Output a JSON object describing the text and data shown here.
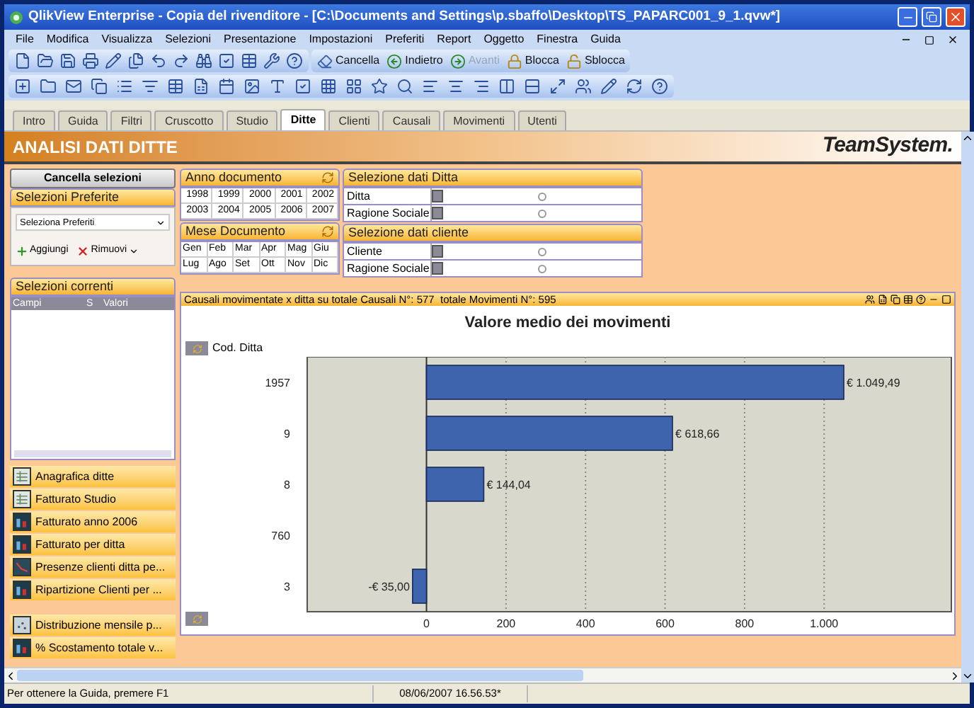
{
  "window": {
    "title": "QlikView Enterprise - Copia del rivenditore - [C:\\Documents and Settings\\p.sbaffo\\Desktop\\TS_PAPARC001_9_1.qvw*]"
  },
  "menu": [
    "File",
    "Modifica",
    "Visualizza",
    "Selezioni",
    "Presentazione",
    "Impostazioni",
    "Preferiti",
    "Report",
    "Oggetto",
    "Finestra",
    "Guida"
  ],
  "toolbar_buttons": [
    {
      "label": "Cancella",
      "kind": "eraser",
      "disabled": false
    },
    {
      "label": "Indietro",
      "kind": "back",
      "disabled": false
    },
    {
      "label": "Avanti",
      "kind": "forward",
      "disabled": true
    },
    {
      "label": "Blocca",
      "kind": "lock",
      "disabled": false
    },
    {
      "label": "Sblocca",
      "kind": "unlock",
      "disabled": false
    }
  ],
  "tabs": [
    {
      "label": "Intro",
      "selected": false
    },
    {
      "label": "Guida",
      "selected": false
    },
    {
      "label": "Filtri",
      "selected": false
    },
    {
      "label": "Cruscotto",
      "selected": false
    },
    {
      "label": "Studio",
      "selected": false
    },
    {
      "label": "Ditte",
      "selected": true
    },
    {
      "label": "Clienti",
      "selected": false
    },
    {
      "label": "Causali",
      "selected": false
    },
    {
      "label": "Movimenti",
      "selected": false
    },
    {
      "label": "Utenti",
      "selected": false
    }
  ],
  "header": {
    "title": "ANALISI DATI DITTE",
    "logo": "TeamSystem."
  },
  "left_panel": {
    "clear_button": "Cancella selezioni",
    "favorites": {
      "title": "Selezioni Preferite",
      "dropdown": "Seleziona Preferiti",
      "add": "Aggiungi",
      "remove": "Rimuovi"
    },
    "current": {
      "title": "Selezioni correnti",
      "columns": [
        "Campi",
        "S",
        "Valori"
      ]
    },
    "report_groups": [
      [
        {
          "label": "Anagrafica ditte",
          "kind": "table"
        },
        {
          "label": "Fatturato Studio",
          "kind": "table"
        },
        {
          "label": "Fatturato anno 2006",
          "kind": "bar"
        },
        {
          "label": "Fatturato per ditta",
          "kind": "bar"
        },
        {
          "label": "Presenze clienti ditta pe...",
          "kind": "line"
        },
        {
          "label": "Ripartizione Clienti per ...",
          "kind": "bar"
        }
      ],
      [
        {
          "label": "Distribuzione mensile p...",
          "kind": "scatter"
        },
        {
          "label": "% Scostamento totale v...",
          "kind": "bar"
        }
      ]
    ]
  },
  "anno_documento": {
    "title": "Anno documento",
    "values": [
      "1998",
      "1999",
      "2000",
      "2001",
      "2002",
      "2003",
      "2004",
      "2005",
      "2006",
      "2007"
    ]
  },
  "mese_documento": {
    "title": "Mese Documento",
    "values": [
      "Gen",
      "Feb",
      "Mar",
      "Apr",
      "Mag",
      "Giu",
      "Lug",
      "Ago",
      "Set",
      "Ott",
      "Nov",
      "Dic"
    ]
  },
  "selezione_ditta": {
    "title": "Selezione dati Ditta",
    "fields": [
      "Ditta",
      "Ragione Sociale"
    ]
  },
  "selezione_cliente": {
    "title": "Selezione dati cliente",
    "fields": [
      "Cliente",
      "Ragione Sociale"
    ]
  },
  "chart_panel": {
    "caption": "Causali movimentate x ditta su totale Causali N°: 577  totale Movimenti N°: 595",
    "title": "Valore medio dei movimenti",
    "dimension": "Cod. Ditta",
    "chart_data": {
      "type": "bar",
      "orientation": "horizontal",
      "categories": [
        "1957",
        "9",
        "8",
        "760",
        "3"
      ],
      "values": [
        1049.49,
        618.66,
        144.04,
        null,
        -35
      ],
      "xlim": [
        -300,
        1320
      ],
      "grid": true,
      "xticks": [
        {
          "value": 0,
          "label": "0"
        },
        {
          "value": 200,
          "label": "200"
        },
        {
          "value": 400,
          "label": "400"
        },
        {
          "value": 600,
          "label": "600"
        },
        {
          "value": 800,
          "label": "800"
        },
        {
          "value": 1000,
          "label": "1.000"
        }
      ],
      "value_labels": [
        "€ 1.049,49",
        "€ 618,66",
        "€ 144,04",
        null,
        "-€ 35,00"
      ]
    }
  },
  "status_bar": {
    "help": "Per ottenere la Guida, premere F1",
    "timestamp": "08/06/2007 16.56.53*"
  }
}
